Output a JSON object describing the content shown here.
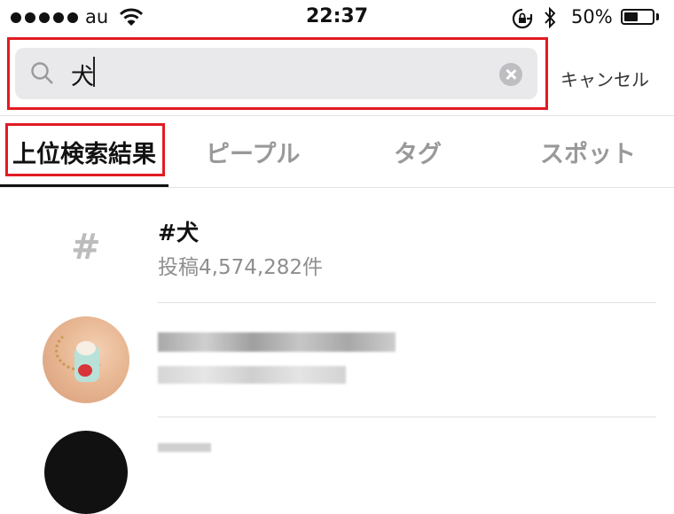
{
  "status_bar": {
    "carrier": "au",
    "time": "22:37",
    "battery": "50%",
    "battery_level": 0.5
  },
  "search": {
    "query": "犬",
    "cancel_label": "キャンセル"
  },
  "tabs": [
    {
      "label": "上位検索結果",
      "active": true
    },
    {
      "label": "ピープル",
      "active": false
    },
    {
      "label": "タグ",
      "active": false
    },
    {
      "label": "スポット",
      "active": false
    }
  ],
  "results": [
    {
      "type": "hashtag",
      "icon": "hashtag-icon",
      "title": "#犬",
      "subtitle": "投稿4,574,282件"
    },
    {
      "type": "user",
      "icon": "avatar",
      "title": "",
      "subtitle": ""
    },
    {
      "type": "user",
      "icon": "avatar",
      "title": "",
      "subtitle": ""
    }
  ],
  "colors": {
    "highlight": "#e21a22",
    "search_bg": "#e9e9eb",
    "inactive_tab": "#999999"
  }
}
